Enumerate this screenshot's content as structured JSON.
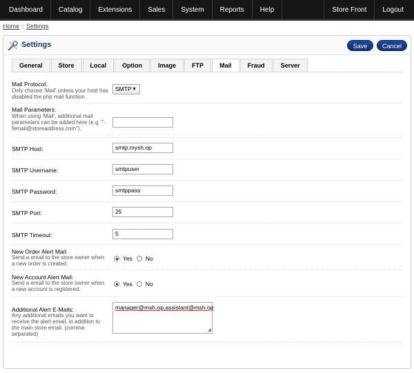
{
  "nav": {
    "left": [
      "Dashboard",
      "Catalog",
      "Extensions",
      "Sales",
      "System",
      "Reports",
      "Help"
    ],
    "right": [
      "Store Front",
      "Logout"
    ]
  },
  "breadcrumb": {
    "home": "Home",
    "sep": " :: ",
    "current": "Settings"
  },
  "heading": {
    "title": "Settings",
    "save": "Save",
    "cancel": "Cancel"
  },
  "tabs": [
    "General",
    "Store",
    "Local",
    "Option",
    "Image",
    "FTP",
    "Mail",
    "Fraud",
    "Server"
  ],
  "active_tab": "Mail",
  "form": {
    "mail_protocol": {
      "label": "Mail Protocol:",
      "help": "Only choose 'Mail' unless your host has disabled the php mail function.",
      "value": "SMTP"
    },
    "mail_parameters": {
      "label": "Mail Parameters:",
      "help": "When using 'Mail', additional mail parameters can be added here (e.g. \"-femail@storeaddress.com\").",
      "value": ""
    },
    "smtp_host": {
      "label": "SMTP Host:",
      "value": "smtp.mysh.op"
    },
    "smtp_username": {
      "label": "SMTP Username:",
      "value": "smtpuser"
    },
    "smtp_password": {
      "label": "SMTP Password:",
      "value": "smtppass"
    },
    "smtp_port": {
      "label": "SMTP Port:",
      "value": "25"
    },
    "smtp_timeout": {
      "label": "SMTP Timeout:",
      "value": "5"
    },
    "new_order_alert": {
      "label": "New Order Alert Mail:",
      "help": "Send a email to the store owner when a new order is created.",
      "yes": "Yes",
      "no": "No",
      "selected": "Yes"
    },
    "new_account_alert": {
      "label": "New Account Alert Mail:",
      "help": "Send a email to the store owner when a new account is registered.",
      "yes": "Yes",
      "no": "No",
      "selected": "Yes"
    },
    "alert_emails": {
      "label": "Additional Alert E-Mails:",
      "help": "Any additional emails you want to receive the alert email, in addition to the main store email. (comma separated)",
      "value": "manager@msh.op,assistant@msh.op"
    }
  }
}
